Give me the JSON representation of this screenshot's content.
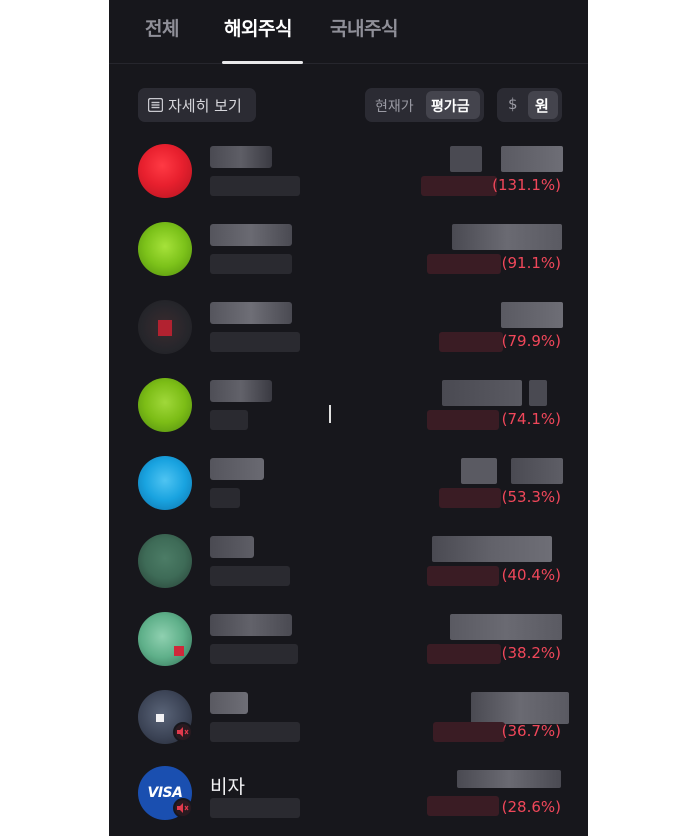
{
  "tabs": [
    {
      "label": "전체",
      "active": false
    },
    {
      "label": "해외주식",
      "active": true
    },
    {
      "label": "국내주식",
      "active": false
    }
  ],
  "controls": {
    "detail_label": "자세히 보기",
    "price_mode": {
      "options": [
        "현재가",
        "평가금"
      ],
      "selected": "평가금"
    },
    "currency": {
      "options": [
        "$",
        "원"
      ],
      "selected": "원"
    }
  },
  "holdings": [
    {
      "name": "",
      "return_pct": "(131.1%)",
      "logo_color": "#e8202e",
      "name_hidden": true
    },
    {
      "name": "",
      "return_pct": "(91.1%)",
      "logo_color": "#7cc21a",
      "name_hidden": true
    },
    {
      "name": "",
      "return_pct": "(79.9%)",
      "logo_color": "#2a2a2e",
      "name_hidden": true
    },
    {
      "name": "",
      "return_pct": "(74.1%)",
      "logo_color": "#7cbd16",
      "name_hidden": true
    },
    {
      "name": "",
      "return_pct": "(53.3%)",
      "logo_color": "#19a3e0",
      "name_hidden": true
    },
    {
      "name": "",
      "return_pct": "(40.4%)",
      "logo_color": "#3e6b57",
      "name_hidden": true
    },
    {
      "name": "",
      "return_pct": "(38.2%)",
      "logo_color": "#5fb08a",
      "name_hidden": true
    },
    {
      "name": "",
      "return_pct": "(36.7%)",
      "logo_color": "#3c4456",
      "name_hidden": true
    },
    {
      "name": "비자",
      "return_pct": "(28.6%)",
      "logo_color": "#1a4fb0",
      "logo_text": "VISA",
      "name_hidden": false
    }
  ],
  "colors": {
    "background": "#17171c",
    "positive_return": "#f0475a",
    "chip_bg": "#2b2b33",
    "chip_selected": "#44444d"
  },
  "icons": {
    "detail": "list-icon",
    "mute": "speaker-muted-icon"
  }
}
